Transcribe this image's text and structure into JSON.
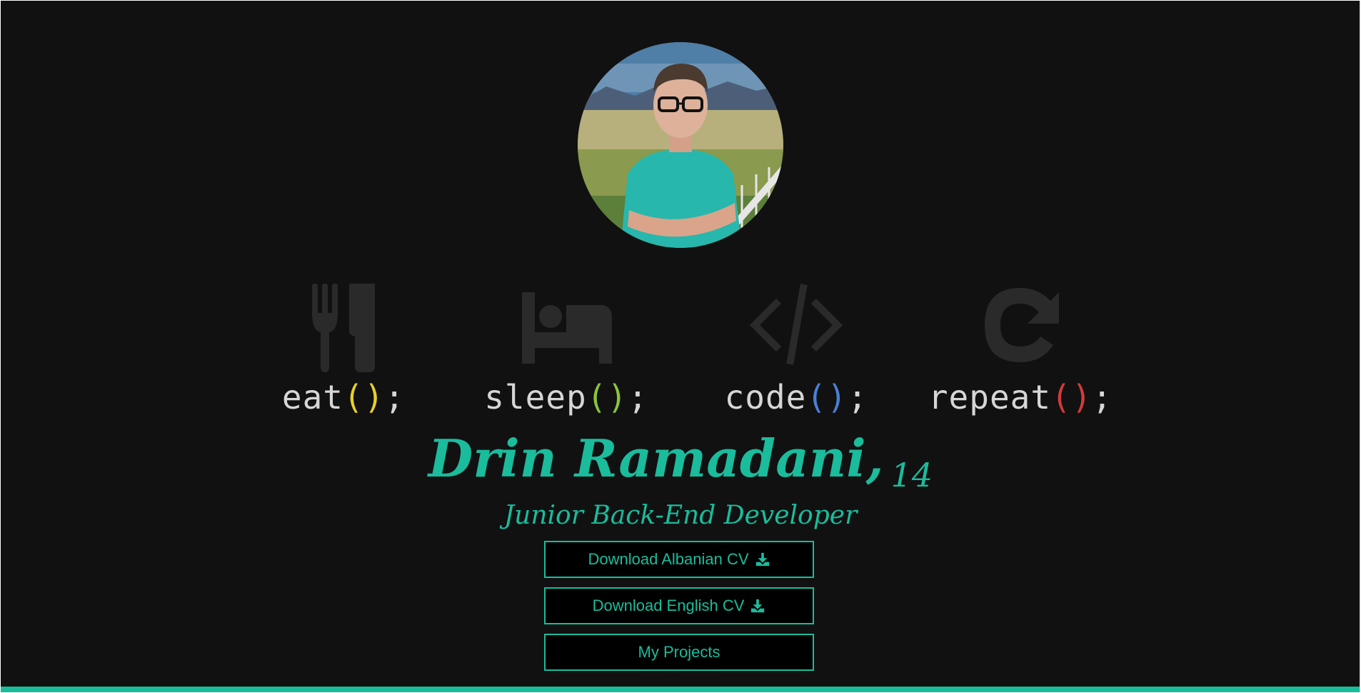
{
  "profile": {
    "name": "Drin Ramadani,",
    "age": "14",
    "role": "Junior Back-End Developer"
  },
  "loop": [
    {
      "icon": "utensils-icon",
      "word": "eat",
      "paren": "()",
      "end": ";",
      "paren_color": "#e6d02e"
    },
    {
      "icon": "bed-icon",
      "word": "sleep",
      "paren": "()",
      "end": ";",
      "paren_color": "#8cc43c"
    },
    {
      "icon": "code-icon",
      "word": "code",
      "paren": "()",
      "end": ";",
      "paren_color": "#4a7fd6"
    },
    {
      "icon": "redo-icon",
      "word": "repeat",
      "paren": "()",
      "end": ";",
      "paren_color": "#d23a3a"
    }
  ],
  "buttons": {
    "cv_albanian": "Download Albanian CV",
    "cv_english": "Download English CV",
    "projects": "My Projects"
  },
  "colors": {
    "background": "#111111",
    "accent": "#1abc9c",
    "icon": "#2a2a2a",
    "code_text": "#d6d6d6"
  }
}
